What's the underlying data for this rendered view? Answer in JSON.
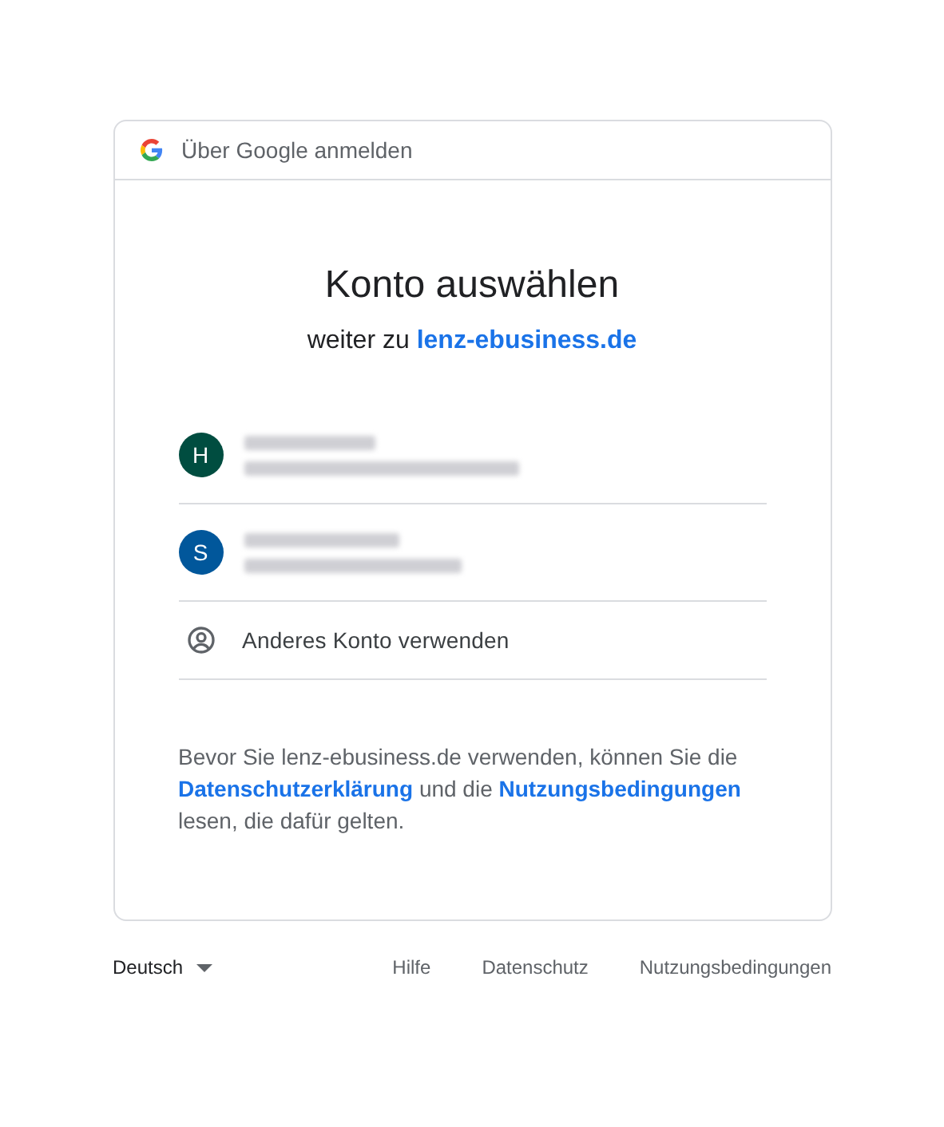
{
  "header": {
    "title": "Über Google anmelden"
  },
  "heading": "Konto auswählen",
  "subtitle": {
    "prefix": "weiter zu",
    "link": "lenz-ebusiness.de"
  },
  "accounts": [
    {
      "kind": "account",
      "initial": "H",
      "color": "#004d40"
    },
    {
      "kind": "account",
      "initial": "S",
      "color": "#01579b"
    },
    {
      "kind": "other",
      "label": "Anderes Konto verwenden"
    }
  ],
  "consent": {
    "before": "Bevor Sie lenz-ebusiness.de verwenden, können Sie die",
    "privacy_link": "Datenschutzerklärung",
    "middle": "und die",
    "terms_link": "Nutzungsbedingungen",
    "after": "lesen, die dafür gelten."
  },
  "footer": {
    "language": "Deutsch",
    "links": [
      "Hilfe",
      "Datenschutz",
      "Nutzungsbedingungen"
    ]
  }
}
